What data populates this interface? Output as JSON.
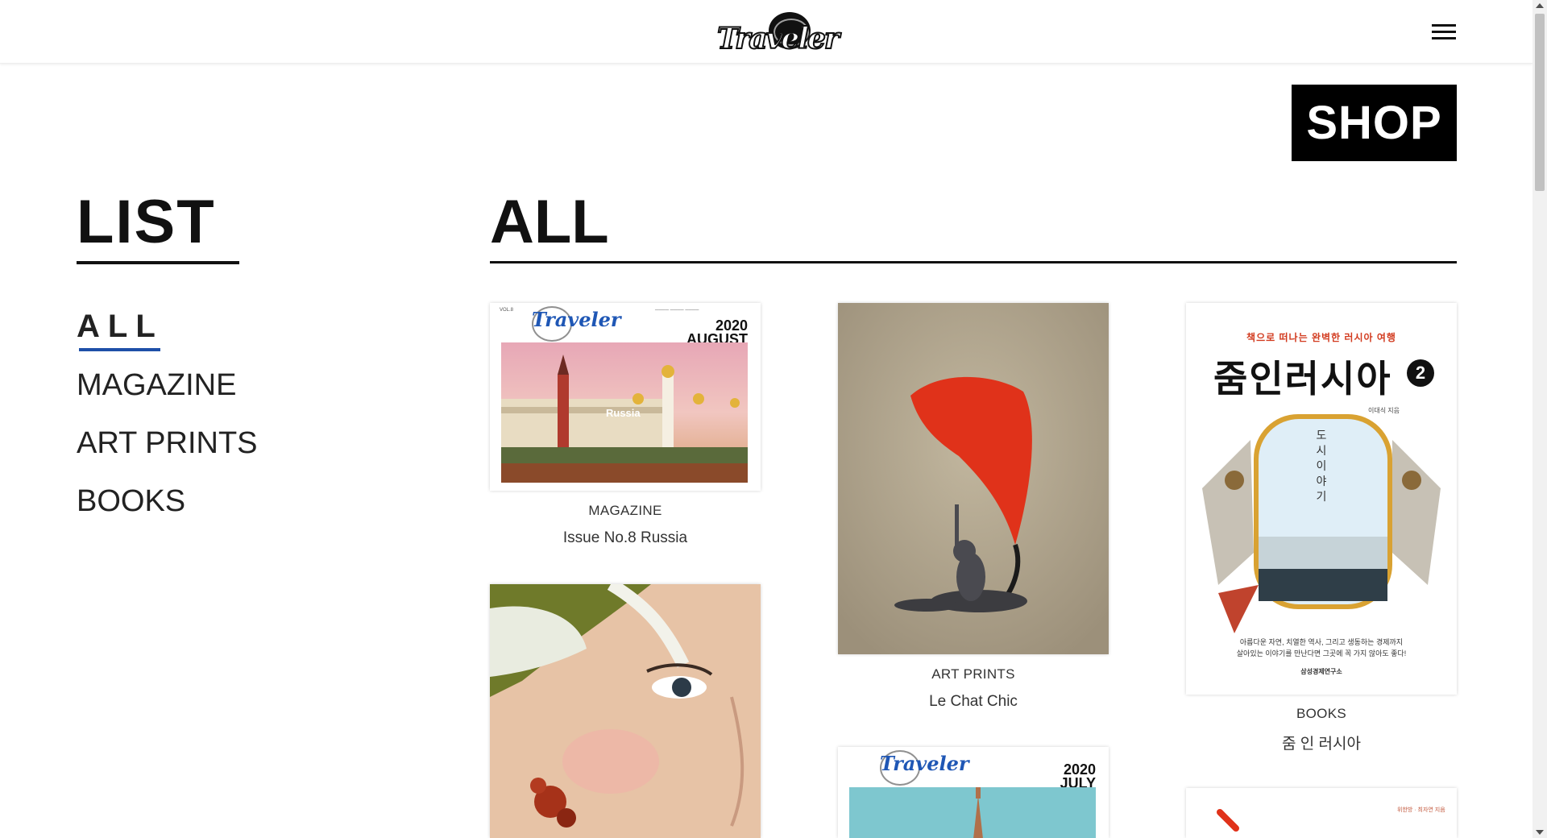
{
  "header": {
    "logo_text": "Traveler",
    "menu_icon": "hamburger-icon"
  },
  "shop_badge": "SHOP",
  "sidebar": {
    "title": "LIST",
    "items": [
      {
        "label": "ALL",
        "active": true
      },
      {
        "label": "MAGAZINE"
      },
      {
        "label": "ART PRINTS"
      },
      {
        "label": "BOOKS"
      }
    ]
  },
  "main": {
    "section_title": "ALL",
    "products": [
      {
        "category": "MAGAZINE",
        "title": "Issue No.8 Russia",
        "cover_year": "2020",
        "cover_month": "AUGUST",
        "cover_logo": "Traveler",
        "cover_headline": "Russia"
      },
      {
        "category": "ART PRINTS",
        "title": "Le Chat Chic"
      },
      {
        "category": "BOOKS",
        "title": "줌 인 러시아",
        "cover_tagline": "책으로 떠나는 완벽한 러시아 여행",
        "cover_title": "줌인러시아",
        "cover_volume": "2",
        "cover_author": "이대식 지음",
        "cover_vertical": "도시 이야기",
        "cover_blurb_1": "아름다운 자연, 치열한 역사, 그리고 생동하는 경제까지",
        "cover_blurb_2": "살아있는 이야기를 만난다면 그곳에 꼭 가지 않아도 좋다!",
        "cover_publisher": "삼성경제연구소"
      },
      {
        "category": "",
        "title": ""
      },
      {
        "category": "",
        "title": "",
        "cover_year": "2020",
        "cover_month": "JULY",
        "cover_logo": "Traveler"
      },
      {
        "category": "",
        "title": "",
        "cover_corner_text": "위한방 · 최자연 지음"
      }
    ]
  },
  "colors": {
    "accent_underline": "#1e4fa8",
    "shop_bg": "#000000",
    "scarf_red": "#e0321a"
  }
}
